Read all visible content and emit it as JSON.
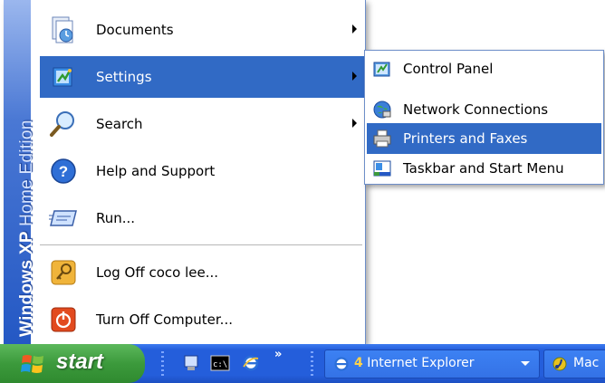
{
  "start_menu": {
    "banner": {
      "brand": "Windows XP",
      "edition": "Home Edition"
    },
    "items": [
      {
        "label": "Documents",
        "icon": "documents-icon",
        "has_submenu": true
      },
      {
        "label": "Settings",
        "icon": "settings-icon",
        "has_submenu": true,
        "highlighted": true
      },
      {
        "label": "Search",
        "icon": "search-icon",
        "has_submenu": true
      },
      {
        "label": "Help and Support",
        "icon": "help-icon",
        "has_submenu": false
      },
      {
        "label": "Run...",
        "icon": "run-icon",
        "has_submenu": false
      }
    ],
    "bottom_items": [
      {
        "label": "Log Off coco lee...",
        "icon": "log-off-key-icon"
      },
      {
        "label": "Turn Off Computer...",
        "icon": "power-icon"
      }
    ]
  },
  "settings_submenu": {
    "items": [
      {
        "label": "Control Panel",
        "icon": "control-panel-icon"
      },
      {
        "label": "Network Connections",
        "icon": "network-globe-icon"
      },
      {
        "label": "Printers and Faxes",
        "icon": "printer-icon",
        "highlighted": true
      },
      {
        "label": "Taskbar and Start Menu",
        "icon": "taskbar-icon"
      }
    ]
  },
  "taskbar": {
    "start_label": "start",
    "quick_launch": [
      "show-desktop-icon",
      "command-prompt-icon",
      "internet-explorer-icon"
    ],
    "overflow_chevron": "»",
    "buttons": [
      {
        "count": "4",
        "label": "Internet Explorer",
        "icon": "internet-explorer-icon"
      },
      {
        "label": "Mac",
        "icon": "media-player-icon"
      }
    ]
  },
  "colors": {
    "highlight": "#316ac5",
    "taskbar": "#245edb",
    "start_button": "#3c9a3c",
    "banner": "#2458c4"
  }
}
